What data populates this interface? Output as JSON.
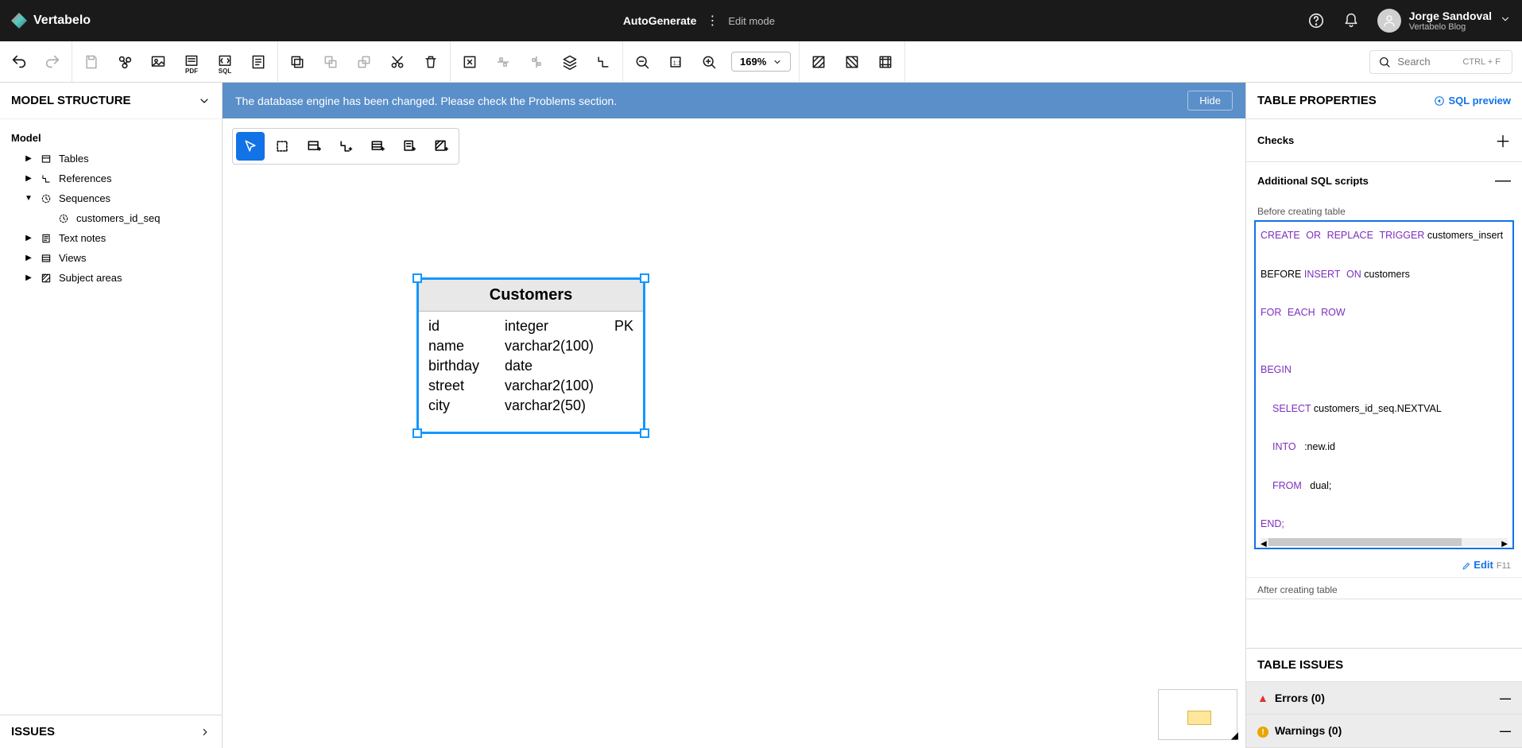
{
  "header": {
    "brand": "Vertabelo",
    "title": "AutoGenerate",
    "mode": "Edit mode",
    "user_name": "Jorge Sandoval",
    "user_sub": "Vertabelo Blog"
  },
  "toolbar": {
    "zoom_value": "169%",
    "search_placeholder": "Search",
    "search_shortcut": "CTRL + F"
  },
  "notice": {
    "message": "The database engine has been changed. Please check the Problems section.",
    "hide_label": "Hide"
  },
  "left": {
    "panel_title": "MODEL STRUCTURE",
    "root": "Model",
    "items": {
      "tables": "Tables",
      "references": "References",
      "sequences": "Sequences",
      "seq_child": "customers_id_seq",
      "textnotes": "Text notes",
      "views": "Views",
      "subjectareas": "Subject areas"
    },
    "issues": "ISSUES"
  },
  "entity": {
    "title": "Customers",
    "cols": [
      {
        "name": "id",
        "type": "integer",
        "pk": "PK"
      },
      {
        "name": "name",
        "type": "varchar2(100)",
        "pk": ""
      },
      {
        "name": "birthday",
        "type": "date",
        "pk": ""
      },
      {
        "name": "street",
        "type": "varchar2(100)",
        "pk": ""
      },
      {
        "name": "city",
        "type": "varchar2(50)",
        "pk": ""
      }
    ]
  },
  "right": {
    "panel_title": "TABLE PROPERTIES",
    "sql_preview": "SQL preview",
    "checks": "Checks",
    "additional": "Additional SQL scripts",
    "before_label": "Before creating table",
    "after_label": "After creating table",
    "edit_label": "Edit",
    "edit_hint": "F11",
    "issues_title": "TABLE ISSUES",
    "errors": "Errors (0)",
    "warnings": "Warnings (0)",
    "sql": {
      "l1a": "CREATE",
      "l1b": "OR",
      "l1c": "REPLACE",
      "l1d": "TRIGGER",
      "l1e": " customers_insert",
      "l2a": "BEFORE ",
      "l2b": "INSERT",
      "l2c": "ON",
      "l2d": " customers",
      "l3a": "FOR",
      "l3b": "EACH",
      "l3c": "ROW",
      "l4": "BEGIN",
      "l5a": "SELECT",
      "l5b": " customers_id_seq.NEXTVAL",
      "l6a": "INTO",
      "l6b": "   :new.id",
      "l7a": "FROM",
      "l7b": "   dual;",
      "l8": "END;"
    }
  }
}
